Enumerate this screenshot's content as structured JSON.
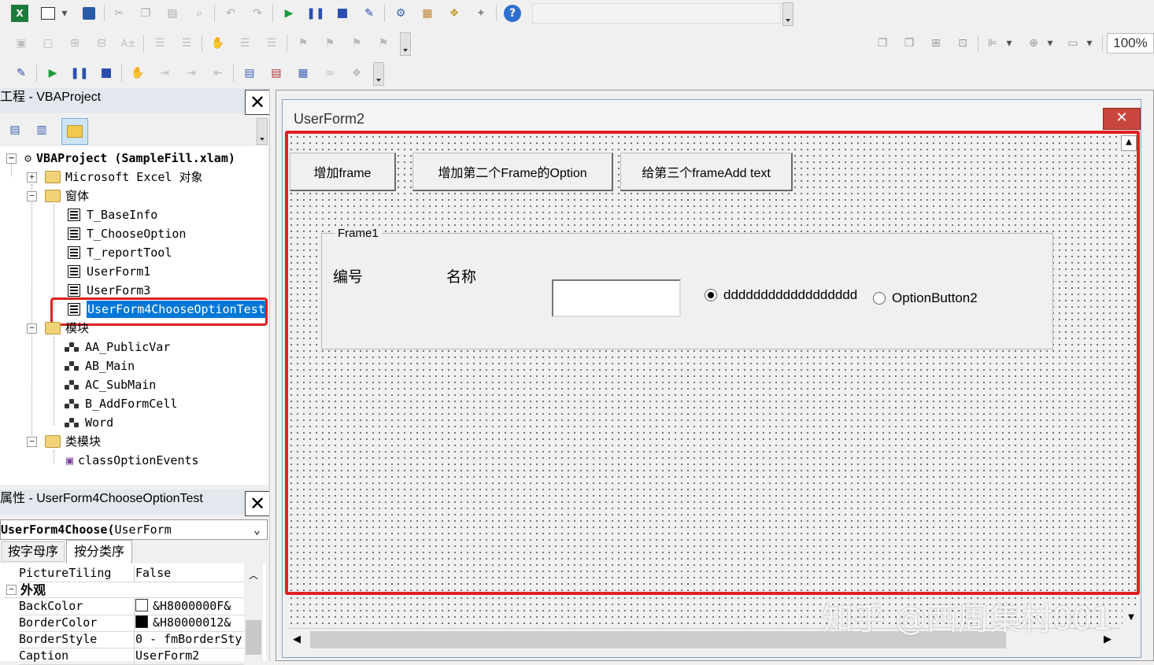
{
  "toolbar": {
    "icons1": [
      "excel-icon",
      "form-icon",
      "dropdown-icon",
      "save-icon",
      "cut-icon",
      "copy-icon",
      "paste-icon",
      "find-icon",
      "undo-icon",
      "redo-icon",
      "run-icon",
      "pause-icon",
      "stop-icon",
      "design-mode-icon",
      "project-explorer-icon",
      "properties-icon",
      "object-browser-icon",
      "toolbox-icon",
      "help-icon"
    ],
    "zoom": "100%"
  },
  "project_panel": {
    "title": "工程 - VBAProject",
    "root": "VBAProject (SampleFill.xlam)",
    "excel_objects": "Microsoft Excel 对象",
    "forms_folder": "窗体",
    "forms": [
      "T_BaseInfo",
      "T_ChooseOption",
      "T_reportTool",
      "UserForm1",
      "UserForm3",
      "UserForm4ChooseOptionTest"
    ],
    "modules_folder": "模块",
    "modules": [
      "AA_PublicVar",
      "AB_Main",
      "AC_SubMain",
      "B_AddFormCell",
      "Word"
    ],
    "class_folder": "类模块",
    "classes": [
      "classOptionEvents"
    ]
  },
  "properties_panel": {
    "title": "属性 - UserForm4ChooseOptionTest",
    "object_name": "UserForm4Choose(",
    "object_type": "UserForm",
    "tab_alpha": "按字母序",
    "tab_category": "按分类序",
    "section_appearance": "外观",
    "rows": [
      {
        "name": "PictureTiling",
        "value": "False"
      },
      {
        "name": "BackColor",
        "value": "&H8000000F&",
        "swatch": "#ffffff"
      },
      {
        "name": "BorderColor",
        "value": "&H80000012&",
        "swatch": "#000000"
      },
      {
        "name": "BorderStyle",
        "value": "0 - fmBorderSty"
      },
      {
        "name": "Caption",
        "value": "UserForm2"
      }
    ]
  },
  "designer": {
    "form_caption": "UserForm2",
    "buttons": [
      "增加frame",
      "增加第二个Frame的Option",
      "给第三个frameAdd text"
    ],
    "frame_caption": "Frame1",
    "label_number": "编号",
    "label_name": "名称",
    "textbox_value": "",
    "option1_label": "dddddddddddddddddd",
    "option2_label": "OptionButton2"
  },
  "watermark": "知乎 @西周集村001",
  "colors": {
    "highlight": "#e02020",
    "selection": "#0078d7"
  }
}
